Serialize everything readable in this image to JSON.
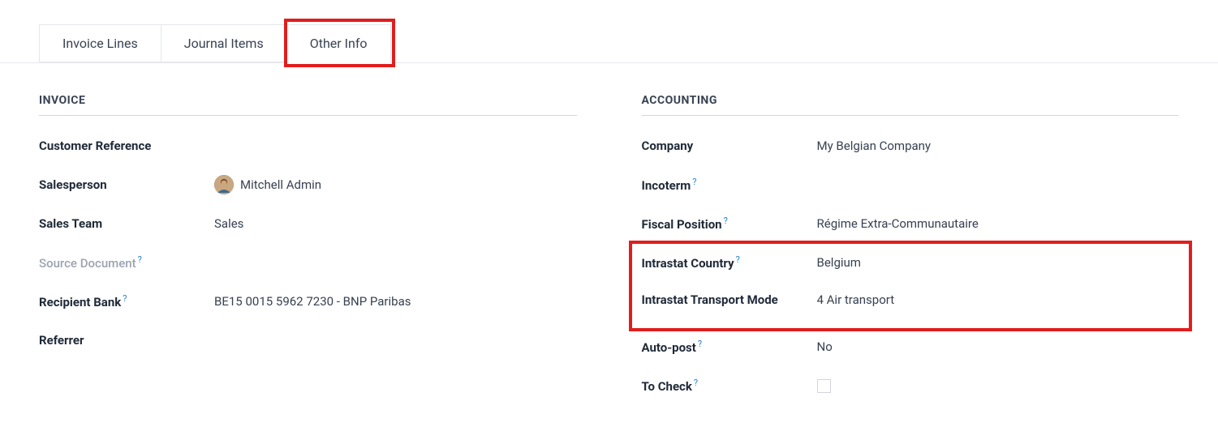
{
  "tabs": [
    {
      "label": "Invoice Lines"
    },
    {
      "label": "Journal Items"
    },
    {
      "label": "Other Info"
    }
  ],
  "invoice": {
    "heading": "INVOICE",
    "customer_reference_label": "Customer Reference",
    "salesperson_label": "Salesperson",
    "salesperson_value": "Mitchell Admin",
    "sales_team_label": "Sales Team",
    "sales_team_value": "Sales",
    "source_document_label": "Source Document",
    "recipient_bank_label": "Recipient Bank",
    "recipient_bank_value": "BE15 0015 5962 7230 - BNP Paribas",
    "referrer_label": "Referrer"
  },
  "accounting": {
    "heading": "ACCOUNTING",
    "company_label": "Company",
    "company_value": "My Belgian Company",
    "incoterm_label": "Incoterm",
    "fiscal_position_label": "Fiscal Position",
    "fiscal_position_value": "Régime Extra-Communautaire",
    "intrastat_country_label": "Intrastat Country",
    "intrastat_country_value": "Belgium",
    "intrastat_transport_mode_label": "Intrastat Transport Mode",
    "intrastat_transport_mode_value": "4 Air transport",
    "auto_post_label": "Auto-post",
    "auto_post_value": "No",
    "to_check_label": "To Check"
  },
  "help_glyph": "?"
}
